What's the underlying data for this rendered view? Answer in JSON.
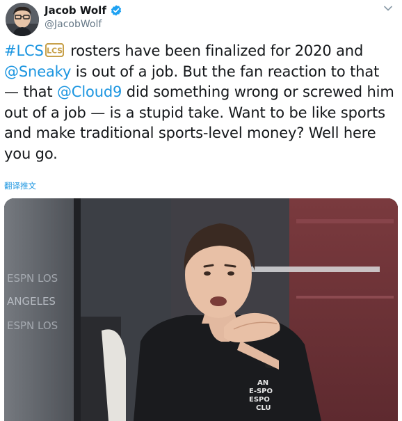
{
  "tweet": {
    "author": {
      "display_name": "Jacob Wolf",
      "handle": "@JacobWolf",
      "verified": true
    },
    "text_parts": [
      {
        "text": "#LCS",
        "type": "hashtag"
      },
      {
        "text": " rosters have been finalized for 2020 and ",
        "type": "text"
      },
      {
        "text": "@Sneaky",
        "type": "mention"
      },
      {
        "text": " is out of a job. But the fan reaction to that — that ",
        "type": "text"
      },
      {
        "text": "@Cloud9",
        "type": "mention"
      },
      {
        "text": " did something wrong or screwed him out of a job — is a stupid take. Want to be like sports and make traditional sports-level money? Well here you go.",
        "type": "text"
      }
    ],
    "translate_label": "翻译推文",
    "hashtag_emoji": "LCS"
  },
  "icons": {
    "verified": "verified-badge-icon",
    "caret": "chevron-down-icon",
    "hashtag_emoji": "lcs-logo-icon"
  },
  "colors": {
    "link": "#1b95e0",
    "text": "#14171a",
    "muted": "#657786",
    "lcs_gold": "#c8a14b"
  },
  "media_overlay_text": {
    "wall_top": "ESPN LOS",
    "wall_mid": "ANGELES",
    "wall_bottom": "ESPN LOS",
    "shirt": "AN E-SPORTS ESPORTS CLUB"
  }
}
